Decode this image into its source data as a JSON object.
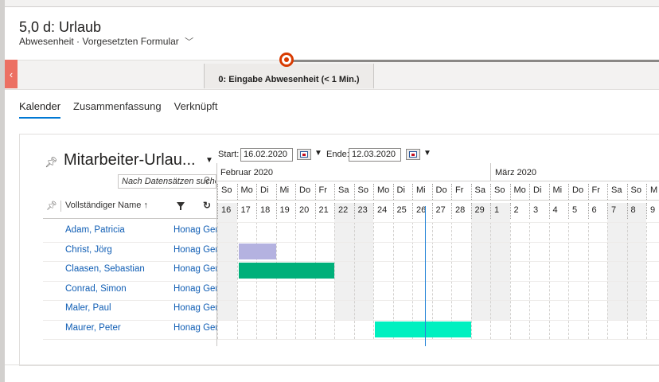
{
  "header": {
    "title": "5,0 d: Urlaub",
    "subtitle": "Abwesenheit · Vorgesetzten Formular"
  },
  "process_flow": {
    "stage_label": "0: Eingabe Abwesenheit  (< 1 Min.)"
  },
  "tabs": [
    {
      "label": "Kalender",
      "active": true
    },
    {
      "label": "Zusammenfassung",
      "active": false
    },
    {
      "label": "Verknüpft",
      "active": false
    }
  ],
  "grid": {
    "title": "Mitarbeiter-Urlau...",
    "search_placeholder": "Nach Datensätzen suchen",
    "column_name": "Vollständiger Name",
    "sort_icon": "↑",
    "rows": [
      {
        "name": "Adam, Patricia",
        "company": "Honag Ger"
      },
      {
        "name": "Christ, Jörg",
        "company": "Honag Ger"
      },
      {
        "name": "Claasen, Sebastian",
        "company": "Honag Ger"
      },
      {
        "name": "Conrad, Simon",
        "company": "Honag Ger"
      },
      {
        "name": "Maler, Paul",
        "company": "Honag Ger"
      },
      {
        "name": "Maurer, Peter",
        "company": "Honag Ger"
      }
    ]
  },
  "timeline": {
    "start_label": "Start:",
    "start_value": "16.02.2020",
    "end_label": "Ende:",
    "end_value": "12.03.2020",
    "months": [
      "Februar 2020",
      "März 2020"
    ],
    "weekdays": [
      "So",
      "Mo",
      "Di",
      "Mi",
      "Do",
      "Fr",
      "Sa",
      "So",
      "Mo",
      "Di",
      "Mi",
      "Do",
      "Fr",
      "Sa",
      "So",
      "Mo",
      "Di",
      "Mi",
      "Do",
      "Fr",
      "Sa",
      "So",
      "M"
    ],
    "days": [
      "16",
      "17",
      "18",
      "19",
      "20",
      "21",
      "22",
      "23",
      "24",
      "25",
      "26",
      "27",
      "28",
      "29",
      "1",
      "2",
      "3",
      "4",
      "5",
      "6",
      "7",
      "8",
      "9"
    ],
    "absences": [
      {
        "row": 1,
        "start_day_index": 1,
        "length_days": 2,
        "color": "#b4b2e0"
      },
      {
        "row": 2,
        "start_day_index": 1,
        "length_days": 5,
        "color": "#00b07a"
      },
      {
        "row": 5,
        "start_day_index": 8,
        "length_days": 5,
        "color": "#00f0c0"
      }
    ],
    "today_index": 10
  },
  "colors": {
    "accent": "#0078d4",
    "link": "#0f5db4",
    "stage_marker": "#d83b01"
  }
}
